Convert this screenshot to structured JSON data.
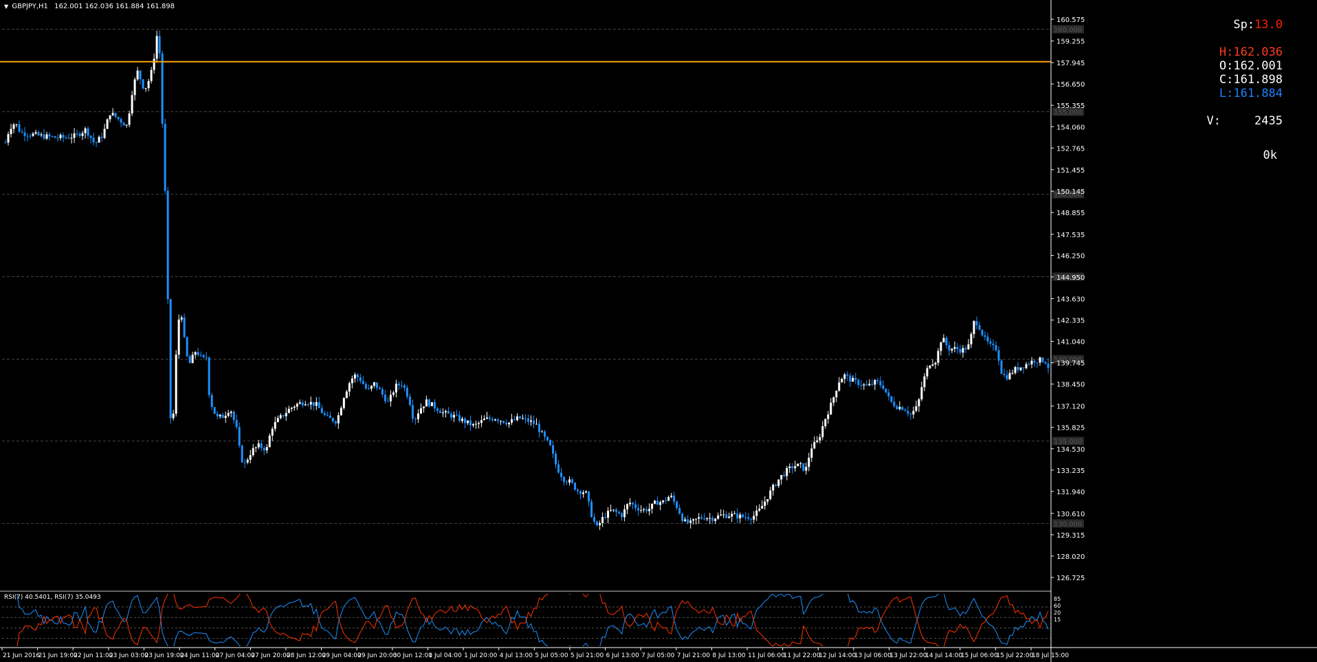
{
  "header": {
    "symbol": "GBPJPY,H1",
    "ohlc": "162.001 162.036 161.884 161.898"
  },
  "info_panel": {
    "spread_label": "Sp:",
    "spread_value": "13.0",
    "high": "H:162.036",
    "open": "O:162.001",
    "close": "C:161.898",
    "low": "L:161.884",
    "volume_label": "V:",
    "volume_value": "2435",
    "ok": "0k"
  },
  "colors": {
    "background": "#000000",
    "bull": "#ffffff",
    "bear": "#1e90ff",
    "hline": "#ffa500",
    "rsi_blue": "#1e90ff",
    "rsi_red": "#ff3300",
    "grid": "#444444",
    "text": "#ffffff",
    "spread": "#ff2200",
    "high": "#ff3b1f",
    "low": "#1e7fff"
  },
  "price_axis": {
    "ticks": [
      "160.575",
      "159.255",
      "157.945",
      "156.650",
      "155.355",
      "154.060",
      "152.765",
      "151.455",
      "150.145",
      "148.855",
      "147.535",
      "146.250",
      "144.950",
      "143.630",
      "142.335",
      "141.040",
      "139.745",
      "138.450",
      "137.120",
      "135.825",
      "134.530",
      "133.235",
      "131.940",
      "130.610",
      "129.315",
      "128.020",
      "126.725"
    ],
    "grid_levels": [
      "160.000",
      "155.000",
      "150.000",
      "145.000",
      "140.000",
      "135.000",
      "130.000"
    ],
    "horizontal_line": "158.000"
  },
  "time_axis": {
    "labels": [
      "21 Jun 2016",
      "21 Jun 19:00",
      "22 Jun 11:00",
      "23 Jun 03:00",
      "23 Jun 19:00",
      "24 Jun 11:00",
      "27 Jun 04:00",
      "27 Jun 20:00",
      "28 Jun 12:00",
      "29 Jun 04:00",
      "29 Jun 20:00",
      "30 Jun 12:00",
      "1 Jul 04:00",
      "1 Jul 20:00",
      "4 Jul 13:00",
      "5 Jul 05:00",
      "5 Jul 21:00",
      "6 Jul 13:00",
      "7 Jul 05:00",
      "7 Jul 21:00",
      "8 Jul 13:00",
      "11 Jul 06:00",
      "11 Jul 22:00",
      "12 Jul 14:00",
      "13 Jul 06:00",
      "13 Jul 22:00",
      "14 Jul 14:00",
      "15 Jul 06:00",
      "15 Jul 22:00",
      "18 Jul 15:00"
    ]
  },
  "rsi": {
    "label": "RSI(7) 40.5401, RSI(7) 35.0493",
    "scale": [
      "85",
      "60",
      "20",
      "15"
    ]
  },
  "chart_data": {
    "type": "candlestick",
    "symbol": "GBPJPY",
    "timeframe": "H1",
    "ylim": [
      126.725,
      160.575
    ],
    "anchors": [
      [
        0,
        152.1
      ],
      [
        6,
        152.8
      ],
      [
        14,
        154.0
      ],
      [
        22,
        154.3
      ],
      [
        30,
        153.7
      ],
      [
        45,
        153.6
      ],
      [
        60,
        153.5
      ],
      [
        80,
        153.4
      ],
      [
        95,
        153.4
      ],
      [
        110,
        153.5
      ],
      [
        125,
        153.9
      ],
      [
        138,
        153.0
      ],
      [
        150,
        153.6
      ],
      [
        160,
        154.9
      ],
      [
        170,
        154.6
      ],
      [
        185,
        154.1
      ],
      [
        193,
        156.4
      ],
      [
        200,
        157.4
      ],
      [
        205,
        156.9
      ],
      [
        210,
        156.3
      ],
      [
        215,
        156.7
      ],
      [
        222,
        157.6
      ],
      [
        228,
        159.6
      ],
      [
        233,
        158.3
      ],
      [
        238,
        151.9
      ],
      [
        242,
        148.5
      ],
      [
        246,
        139.1
      ],
      [
        250,
        134.1
      ],
      [
        254,
        138.8
      ],
      [
        258,
        141.3
      ],
      [
        262,
        143.3
      ],
      [
        266,
        142.1
      ],
      [
        270,
        140.3
      ],
      [
        276,
        139.7
      ],
      [
        285,
        140.5
      ],
      [
        295,
        139.9
      ],
      [
        300,
        140.2
      ],
      [
        305,
        137.5
      ],
      [
        315,
        136.4
      ],
      [
        325,
        136.5
      ],
      [
        335,
        137.0
      ],
      [
        345,
        135.6
      ],
      [
        350,
        134.0
      ],
      [
        356,
        133.6
      ],
      [
        366,
        134.4
      ],
      [
        376,
        134.7
      ],
      [
        388,
        134.5
      ],
      [
        395,
        135.8
      ],
      [
        405,
        136.3
      ],
      [
        420,
        136.9
      ],
      [
        430,
        137.2
      ],
      [
        445,
        137.4
      ],
      [
        460,
        137.2
      ],
      [
        475,
        136.4
      ],
      [
        490,
        136.2
      ],
      [
        500,
        137.7
      ],
      [
        510,
        138.7
      ],
      [
        517,
        139.0
      ],
      [
        525,
        138.7
      ],
      [
        535,
        138.0
      ],
      [
        545,
        138.5
      ],
      [
        555,
        137.9
      ],
      [
        565,
        137.3
      ],
      [
        575,
        138.3
      ],
      [
        585,
        138.5
      ],
      [
        595,
        137.6
      ],
      [
        602,
        136.2
      ],
      [
        610,
        136.9
      ],
      [
        620,
        137.4
      ],
      [
        635,
        137.0
      ],
      [
        645,
        136.7
      ],
      [
        660,
        136.5
      ],
      [
        675,
        136.2
      ],
      [
        690,
        135.9
      ],
      [
        705,
        136.3
      ],
      [
        720,
        136.4
      ],
      [
        740,
        136.1
      ],
      [
        755,
        136.4
      ],
      [
        770,
        136.2
      ],
      [
        780,
        136.0
      ],
      [
        790,
        135.3
      ],
      [
        800,
        134.7
      ],
      [
        810,
        133.4
      ],
      [
        820,
        132.7
      ],
      [
        830,
        132.5
      ],
      [
        840,
        132.0
      ],
      [
        852,
        131.9
      ],
      [
        860,
        130.6
      ],
      [
        868,
        129.7
      ],
      [
        878,
        130.4
      ],
      [
        890,
        130.8
      ],
      [
        905,
        130.5
      ],
      [
        915,
        131.3
      ],
      [
        925,
        131.0
      ],
      [
        935,
        130.8
      ],
      [
        945,
        130.9
      ],
      [
        955,
        131.3
      ],
      [
        965,
        131.3
      ],
      [
        975,
        131.7
      ],
      [
        985,
        131.0
      ],
      [
        995,
        130.1
      ],
      [
        1005,
        130.0
      ],
      [
        1015,
        130.3
      ],
      [
        1025,
        130.4
      ],
      [
        1035,
        130.3
      ],
      [
        1050,
        130.5
      ],
      [
        1065,
        130.5
      ],
      [
        1080,
        130.4
      ],
      [
        1095,
        130.4
      ],
      [
        1105,
        130.8
      ],
      [
        1115,
        131.5
      ],
      [
        1125,
        132.2
      ],
      [
        1135,
        132.8
      ],
      [
        1145,
        133.2
      ],
      [
        1155,
        133.5
      ],
      [
        1165,
        133.5
      ],
      [
        1172,
        133.2
      ],
      [
        1180,
        134.6
      ],
      [
        1190,
        135.0
      ],
      [
        1200,
        136.3
      ],
      [
        1210,
        137.3
      ],
      [
        1220,
        138.6
      ],
      [
        1228,
        139.0
      ],
      [
        1238,
        138.7
      ],
      [
        1250,
        138.5
      ],
      [
        1262,
        138.3
      ],
      [
        1275,
        138.6
      ],
      [
        1285,
        138.3
      ],
      [
        1295,
        137.4
      ],
      [
        1305,
        137.1
      ],
      [
        1315,
        137.0
      ],
      [
        1325,
        136.6
      ],
      [
        1335,
        137.1
      ],
      [
        1342,
        138.5
      ],
      [
        1352,
        139.7
      ],
      [
        1362,
        139.9
      ],
      [
        1370,
        141.3
      ],
      [
        1380,
        140.6
      ],
      [
        1390,
        140.6
      ],
      [
        1400,
        140.5
      ],
      [
        1410,
        140.8
      ],
      [
        1418,
        142.4
      ],
      [
        1425,
        141.9
      ],
      [
        1432,
        141.2
      ],
      [
        1442,
        140.7
      ],
      [
        1450,
        140.6
      ],
      [
        1458,
        139.0
      ],
      [
        1466,
        138.9
      ],
      [
        1475,
        139.3
      ],
      [
        1490,
        139.6
      ],
      [
        1505,
        139.9
      ],
      [
        1520,
        139.9
      ],
      [
        1525,
        139.5
      ]
    ],
    "horizontal_line": 158.0
  }
}
